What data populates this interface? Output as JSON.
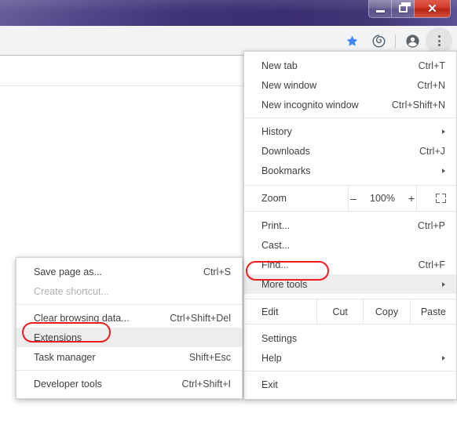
{
  "window": {
    "titlebar_color": "#3f3276",
    "buttons": [
      {
        "name": "minimize",
        "glyph": "minimize-icon"
      },
      {
        "name": "restore",
        "glyph": "restore-icon"
      },
      {
        "name": "close",
        "glyph": "close-icon"
      }
    ]
  },
  "toolbar": {
    "bookmark_star": {
      "icon": "star-icon",
      "color": "#4285f4"
    },
    "extension_swirl": {
      "icon": "spiral-icon",
      "color": "#4d5b6a"
    },
    "profile": {
      "icon": "account-avatar-icon",
      "color": "#5f6368"
    },
    "menu": {
      "icon": "three-dot-menu-icon",
      "color": "#5f6368"
    }
  },
  "main_menu": {
    "items": [
      {
        "label": "New tab",
        "accel": "Ctrl+T",
        "arrow": false
      },
      {
        "label": "New window",
        "accel": "Ctrl+N",
        "arrow": false
      },
      {
        "label": "New incognito window",
        "accel": "Ctrl+Shift+N",
        "arrow": false
      },
      {
        "label": "History",
        "accel": "",
        "arrow": true
      },
      {
        "label": "Downloads",
        "accel": "Ctrl+J",
        "arrow": false
      },
      {
        "label": "Bookmarks",
        "accel": "",
        "arrow": true
      },
      {
        "label": "Print...",
        "accel": "Ctrl+P",
        "arrow": false
      },
      {
        "label": "Cast...",
        "accel": "",
        "arrow": false
      },
      {
        "label": "Find...",
        "accel": "Ctrl+F",
        "arrow": false
      },
      {
        "label": "More tools",
        "accel": "",
        "arrow": true
      },
      {
        "label": "Settings",
        "accel": "",
        "arrow": false
      },
      {
        "label": "Help",
        "accel": "",
        "arrow": true
      },
      {
        "label": "Exit",
        "accel": "",
        "arrow": false
      }
    ],
    "zoom_row": {
      "label": "Zoom",
      "minus": "–",
      "value": "100%",
      "plus": "+",
      "fullscreen_icon": "fullscreen-icon"
    },
    "edit_row": {
      "label": "Edit",
      "cut": "Cut",
      "copy": "Copy",
      "paste": "Paste"
    }
  },
  "sub_menu": {
    "items": [
      {
        "label": "Save page as...",
        "accel": "Ctrl+S",
        "disabled": false,
        "hover": false
      },
      {
        "label": "Create shortcut...",
        "accel": "",
        "disabled": true,
        "hover": false
      },
      {
        "label": "Clear browsing data...",
        "accel": "Ctrl+Shift+Del",
        "disabled": false,
        "hover": false
      },
      {
        "label": "Extensions",
        "accel": "",
        "disabled": false,
        "hover": true
      },
      {
        "label": "Task manager",
        "accel": "Shift+Esc",
        "disabled": false,
        "hover": false
      },
      {
        "label": "Developer tools",
        "accel": "Ctrl+Shift+I",
        "disabled": false,
        "hover": false
      }
    ]
  },
  "annotations": {
    "color": "#ee1c1c",
    "targets": [
      {
        "name": "more-tools-highlight",
        "label": "More tools"
      },
      {
        "name": "extensions-highlight",
        "label": "Extensions"
      }
    ]
  }
}
